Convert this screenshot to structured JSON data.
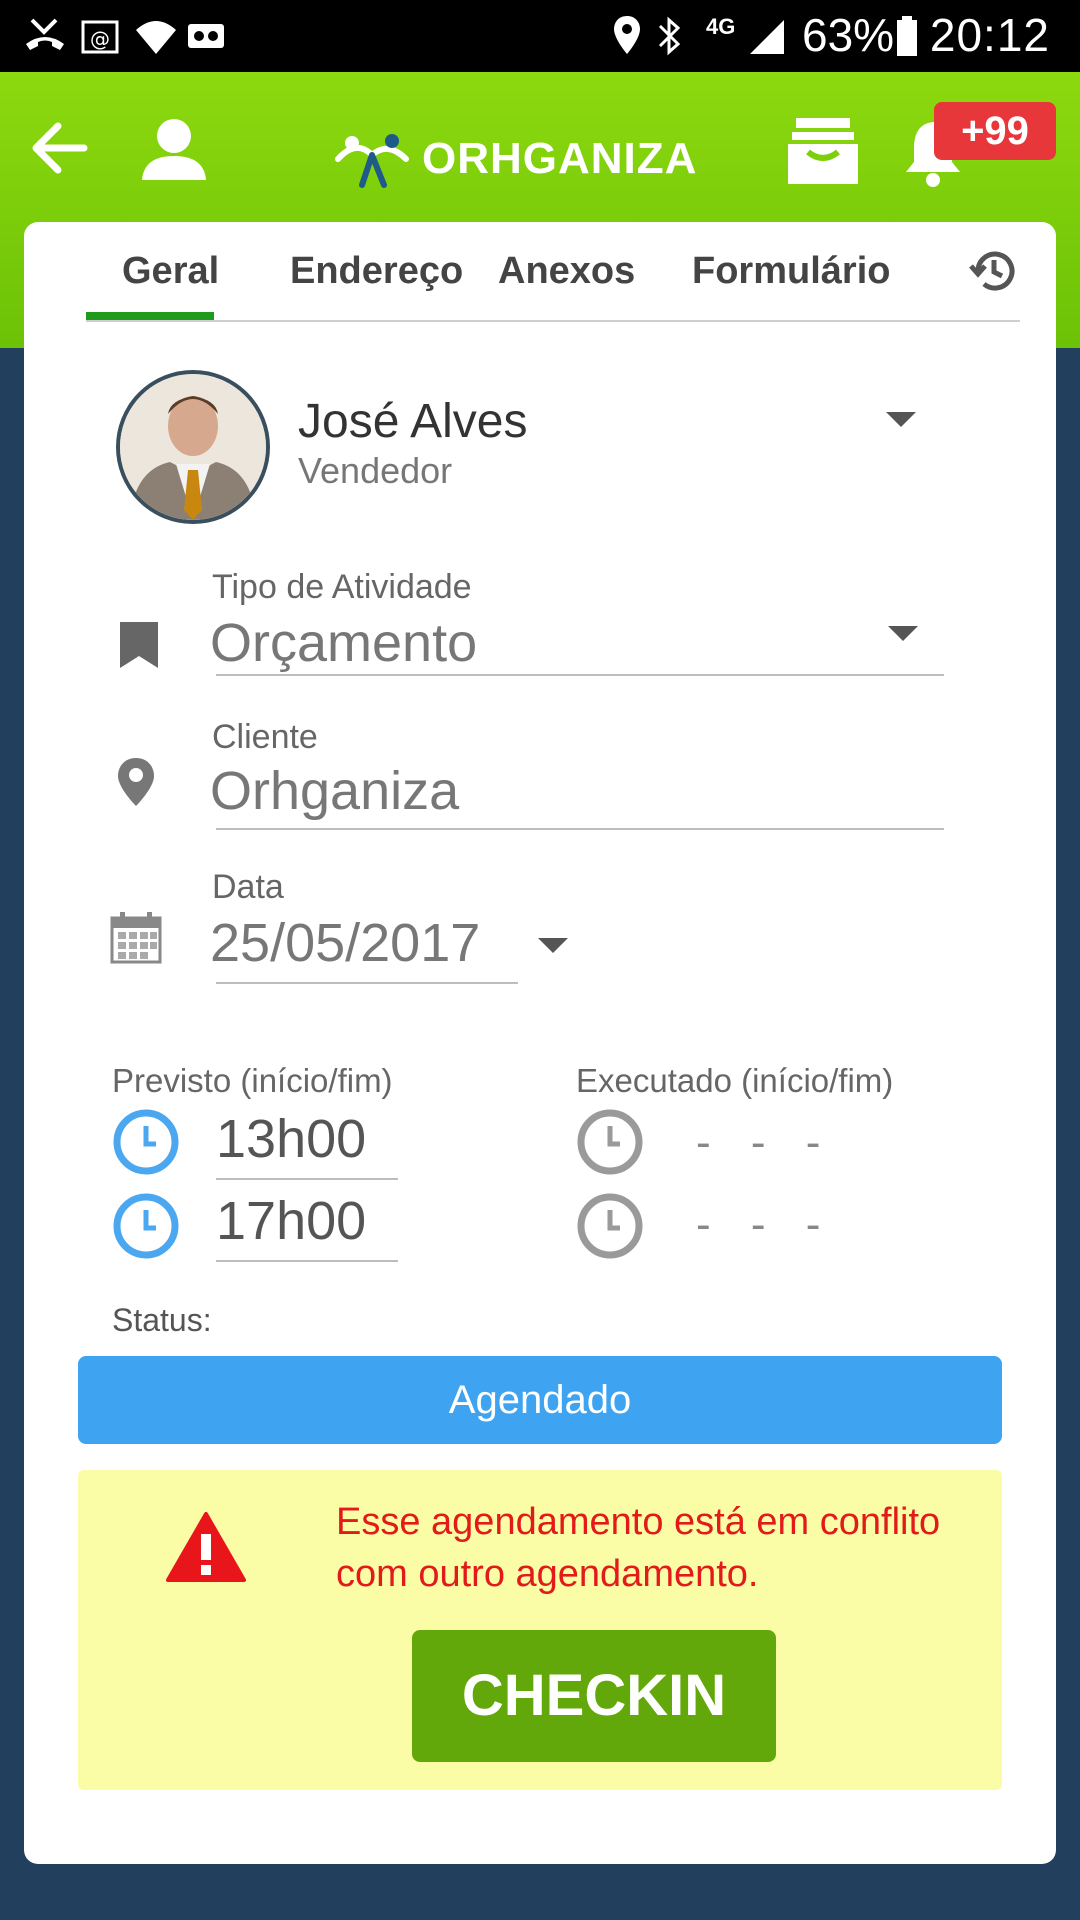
{
  "status_bar": {
    "battery": "63%",
    "time": "20:12",
    "network": "4G"
  },
  "header": {
    "app_name": "ORHGANIZA",
    "notification_badge": "+99"
  },
  "tabs": [
    {
      "label": "Geral"
    },
    {
      "label": "Endereço"
    },
    {
      "label": "Anexos"
    },
    {
      "label": "Formulário"
    }
  ],
  "user": {
    "name": "José Alves",
    "role": "Vendedor"
  },
  "activity": {
    "label": "Tipo de Atividade",
    "value": "Orçamento"
  },
  "client": {
    "label": "Cliente",
    "value": "Orhganiza"
  },
  "date": {
    "label": "Data",
    "value": "25/05/2017"
  },
  "schedule": {
    "planned_label": "Previsto (início/fim)",
    "executed_label": "Executado (início/fim)",
    "planned_start": "13h00",
    "planned_end": "17h00",
    "executed_start": "- - -",
    "executed_end": "- - -"
  },
  "status": {
    "label": "Status:",
    "value": "Agendado"
  },
  "alert": {
    "message": "Esse agendamento está em conflito com outro agendamento.",
    "checkin_label": "CHECKIN"
  },
  "colors": {
    "header_green": "#7dcf0a",
    "tab_indicator": "#1f9a1a",
    "status_blue": "#3ea4f2",
    "alert_bg": "#fafca6",
    "alert_text": "#e21a1a",
    "checkin_green": "#63a80a",
    "badge_red": "#e8373a",
    "page_bg": "#223f5e"
  }
}
